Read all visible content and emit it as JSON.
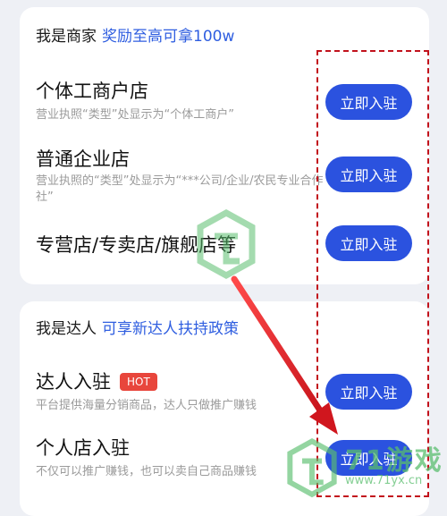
{
  "merchant": {
    "header_label": "我是商家",
    "header_highlight": "奖励至高可拿100w",
    "rows": [
      {
        "title": "个体工商户店",
        "desc": "营业执照“类型”处显示为“个体工商户”",
        "button": "立即入驻"
      },
      {
        "title": "普通企业店",
        "desc": "营业执照的“类型”处显示为“***公司/企业/农民专业合作社”",
        "button": "立即入驻"
      },
      {
        "title": "专营店/专卖店/旗舰店等",
        "desc": "",
        "button": "立即入驻"
      }
    ]
  },
  "creator": {
    "header_label": "我是达人",
    "header_highlight": "可享新达人扶持政策",
    "rows": [
      {
        "title": "达人入驻",
        "badge": "HOT",
        "desc": "平台提供海量分销商品，达人只做推广赚钱",
        "button": "立即入驻"
      },
      {
        "title": "个人店入驻",
        "desc": "不仅可以推广赚钱，也可以卖自己商品赚钱",
        "button": "立即入驻"
      }
    ]
  },
  "watermark": {
    "brand": "71游戏",
    "url": "www.71yx.cn"
  },
  "colors": {
    "accent": "#2f5ee0",
    "button": "#2b52df",
    "badge": "#e8463c",
    "annotation": "#c2121c",
    "watermark": "#5abe6e"
  }
}
